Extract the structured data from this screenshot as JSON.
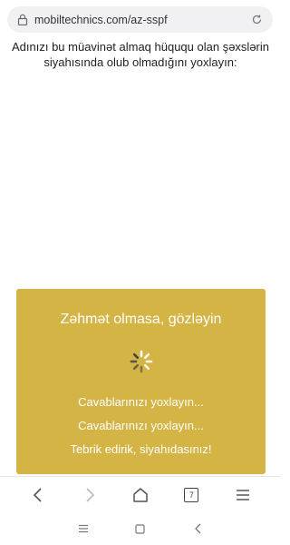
{
  "browser": {
    "url": "mobiltechnics.com/az-sspf",
    "tab_count": "7"
  },
  "page": {
    "intro": "Adınızı bu müavinət almaq hüququ olan şəxslərin siyahısında olub olmadığını yoxlayın:"
  },
  "modal": {
    "title": "Zəhmət olmasa, gözləyin",
    "messages": [
      "Cavablarınızı yoxlayın...",
      "Cavablarınızı yoxlayın...",
      "Tebrik edirik, siyahıdasınız!"
    ],
    "background_color": "#d4b444"
  },
  "icons": {
    "lock": "lock-icon",
    "reload": "reload-icon",
    "spinner": "loading-spinner-icon",
    "back": "back-arrow-icon",
    "forward": "forward-arrow-icon",
    "home": "home-icon",
    "tabs": "tabs-icon",
    "menu": "menu-icon",
    "sys_menu": "recent-apps-icon",
    "sys_home": "square-home-icon",
    "sys_back": "system-back-icon"
  }
}
